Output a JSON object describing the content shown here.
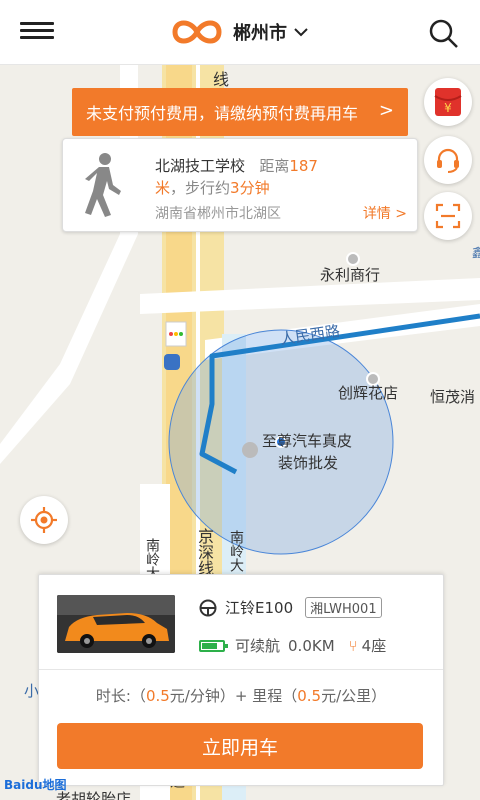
{
  "header": {
    "city": "郴州市",
    "icons": [
      "menu-icon",
      "logo-icon",
      "chevron-down-icon",
      "search-icon"
    ]
  },
  "notice": {
    "text": "未支付预付费用，请缴纳预付费再用车",
    "arrow": ">"
  },
  "destination": {
    "name": "北湖技工学校",
    "distance_prefix": "距离",
    "distance_value": "187",
    "distance_unit": "米",
    "walk_prefix": "，步行约",
    "walk_time": "3分钟",
    "address": "湖南省郴州市北湖区",
    "detail_link": "详情 >"
  },
  "map_labels": {
    "road_top": "线",
    "yongli": "永利商行",
    "renmin_road": "人民西路",
    "chuanghui": "创辉花店",
    "hengmao": "恒茂消",
    "zhizun": "至尊汽车真皮",
    "zhizun2": "装饰批发",
    "jingshen": "京深线",
    "nanling_left": "南岭大",
    "nanling_right": "南岭大",
    "xiao": "小",
    "bottom_shop": "老胡轮胎店",
    "bottom_char": "道",
    "right_edge": "鑫"
  },
  "car": {
    "model": "江铃E100",
    "plate": "湘LWH001",
    "range_label": "可续航",
    "range_value": "0.0KM",
    "seats": "4座",
    "battery_level": 0.7
  },
  "pricing": {
    "prefix": "时长:（",
    "time_price": "0.5",
    "time_unit": "元/分钟）+ 里程（",
    "distance_price": "0.5",
    "distance_unit": "元/公里）"
  },
  "actions": {
    "rent_now": "立即用车"
  },
  "attribution": "Baidu地图",
  "colors": {
    "accent": "#f27a2a",
    "route": "#1f7fc8",
    "battery": "#2db04a"
  }
}
